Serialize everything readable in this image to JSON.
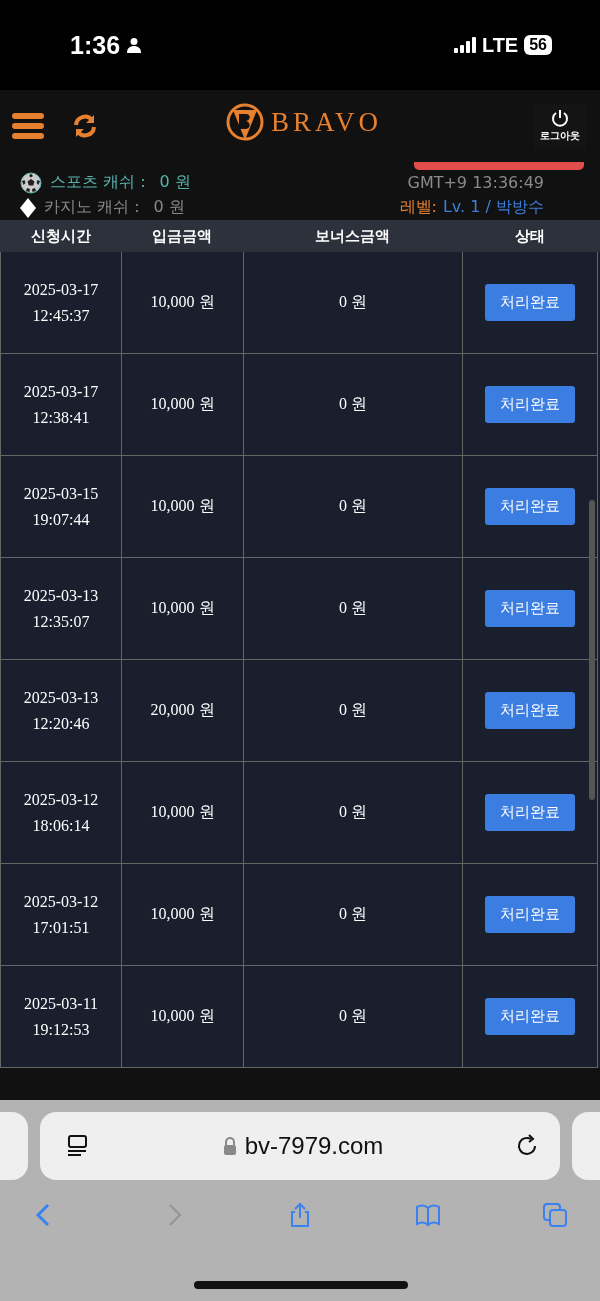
{
  "status_bar": {
    "time": "1:36",
    "network": "LTE",
    "battery": "56"
  },
  "header": {
    "logo": "BRAVO",
    "logout": "로그아웃"
  },
  "info": {
    "sports_label": "스포츠 캐쉬 :",
    "sports_value": "0 원",
    "clock": "GMT+9 13:36:49",
    "casino_label": "카지노 캐쉬 :",
    "casino_value": "0 원",
    "level_label": "레벨:",
    "level_value": "Lv. 1 / 박방수"
  },
  "table": {
    "columns": [
      "신청시간",
      "입금금액",
      "보너스금액",
      "상태"
    ],
    "rows": [
      {
        "requested": "2025-03-17 12:45:37",
        "deposit": "10,000 원",
        "bonus": "0 원",
        "status": "처리완료"
      },
      {
        "requested": "2025-03-17 12:38:41",
        "deposit": "10,000 원",
        "bonus": "0 원",
        "status": "처리완료"
      },
      {
        "requested": "2025-03-15 19:07:44",
        "deposit": "10,000 원",
        "bonus": "0 원",
        "status": "처리완료"
      },
      {
        "requested": "2025-03-13 12:35:07",
        "deposit": "10,000 원",
        "bonus": "0 원",
        "status": "처리완료"
      },
      {
        "requested": "2025-03-13 12:20:46",
        "deposit": "20,000 원",
        "bonus": "0 원",
        "status": "처리완료"
      },
      {
        "requested": "2025-03-12 18:06:14",
        "deposit": "10,000 원",
        "bonus": "0 원",
        "status": "처리완료"
      },
      {
        "requested": "2025-03-12 17:01:51",
        "deposit": "10,000 원",
        "bonus": "0 원",
        "status": "처리완료"
      },
      {
        "requested": "2025-03-11 19:12:53",
        "deposit": "10,000 원",
        "bonus": "0 원",
        "status": "처리완료"
      }
    ]
  },
  "browser": {
    "url": "bv-7979.com",
    "toolbar": [
      {
        "kind": "back",
        "disabled": false
      },
      {
        "kind": "forward",
        "disabled": true
      },
      {
        "kind": "share",
        "disabled": false
      },
      {
        "kind": "bookmarks",
        "disabled": false
      },
      {
        "kind": "tabs",
        "disabled": false
      }
    ]
  }
}
